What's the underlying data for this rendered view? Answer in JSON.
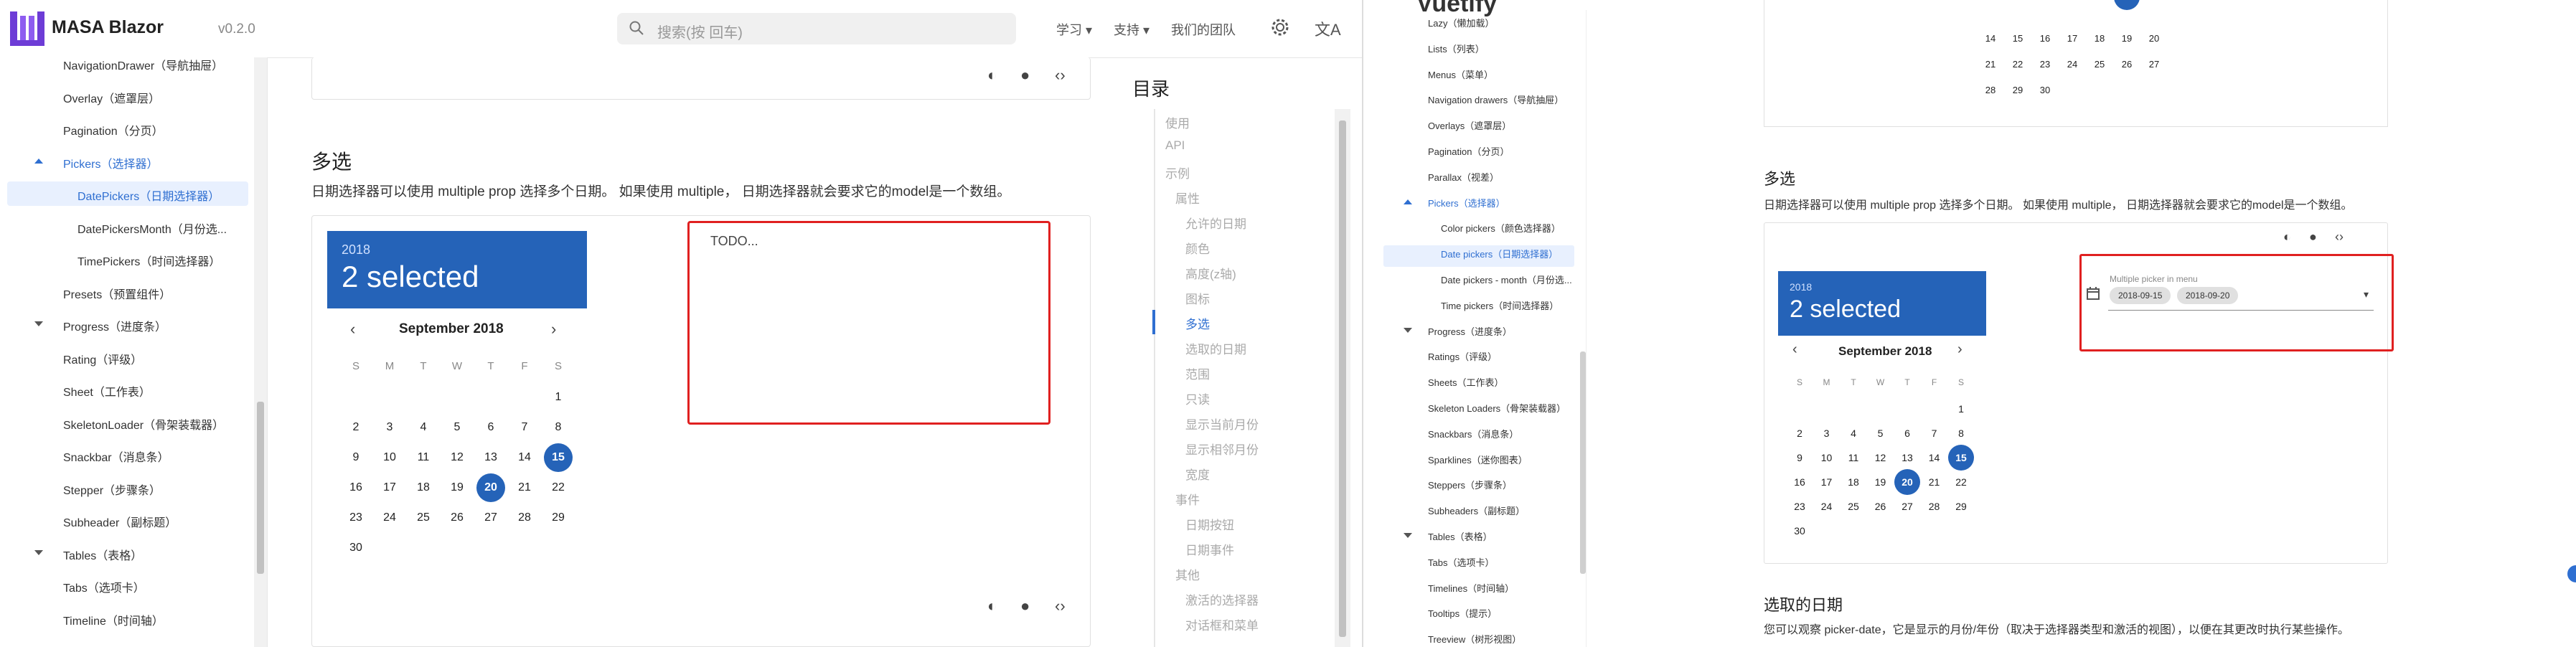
{
  "masa": {
    "brand": "MASA Blazor",
    "version": "v0.2.0",
    "search_placeholder": "搜索(按 回车)",
    "nav": [
      "学习",
      "支持",
      "我们的团队"
    ],
    "sidebar": [
      {
        "label": "NavigationDrawer（导航抽屉）",
        "kind": "item"
      },
      {
        "label": "Overlay（遮罩层）",
        "kind": "item"
      },
      {
        "label": "Pagination（分页）",
        "kind": "item"
      },
      {
        "label": "Pickers（选择器）",
        "kind": "group-open"
      },
      {
        "label": "DatePickers（日期选择器）",
        "kind": "sub-active"
      },
      {
        "label": "DatePickersMonth（月份选...",
        "kind": "sub"
      },
      {
        "label": "TimePickers（时间选择器）",
        "kind": "sub"
      },
      {
        "label": "Presets（预置组件）",
        "kind": "item"
      },
      {
        "label": "Progress（进度条）",
        "kind": "group"
      },
      {
        "label": "Rating（评级）",
        "kind": "item"
      },
      {
        "label": "Sheet（工作表）",
        "kind": "item"
      },
      {
        "label": "SkeletonLoader（骨架装载器）",
        "kind": "item"
      },
      {
        "label": "Snackbar（消息条）",
        "kind": "item"
      },
      {
        "label": "Stepper（步骤条）",
        "kind": "item"
      },
      {
        "label": "Subheader（副标题）",
        "kind": "item"
      },
      {
        "label": "Tables（表格）",
        "kind": "group"
      },
      {
        "label": "Tabs（选项卡）",
        "kind": "item"
      },
      {
        "label": "Timeline（时间轴）",
        "kind": "item"
      }
    ],
    "section_title": "多选",
    "section_desc": "日期选择器可以使用 multiple prop 选择多个日期。 如果使用 multiple， 日期选择器就会要求它的model是一个数组。",
    "picker": {
      "year": "2018",
      "selected": "2 selected",
      "month": "September 2018",
      "dows": [
        "S",
        "M",
        "T",
        "W",
        "T",
        "F",
        "S"
      ],
      "weeks": [
        [
          "",
          "",
          "",
          "",
          "",
          "",
          "1"
        ],
        [
          "2",
          "3",
          "4",
          "5",
          "6",
          "7",
          "8"
        ],
        [
          "9",
          "10",
          "11",
          "12",
          "13",
          "14",
          "15"
        ],
        [
          "16",
          "17",
          "18",
          "19",
          "20",
          "21",
          "22"
        ],
        [
          "23",
          "24",
          "25",
          "26",
          "27",
          "28",
          "29"
        ],
        [
          "30",
          "",
          "",
          "",
          "",
          "",
          ""
        ]
      ],
      "selected_days": [
        "15",
        "20"
      ]
    },
    "todo": "TODO...",
    "toc_title": "目录",
    "toc": [
      {
        "label": "使用",
        "level": 0
      },
      {
        "label": "API",
        "level": 0
      },
      {
        "label": "示例",
        "level": 0
      },
      {
        "label": "属性",
        "level": 1
      },
      {
        "label": "允许的日期",
        "level": 2
      },
      {
        "label": "颜色",
        "level": 2
      },
      {
        "label": "高度(z轴)",
        "level": 2
      },
      {
        "label": "图标",
        "level": 2
      },
      {
        "label": "多选",
        "level": 2,
        "active": true
      },
      {
        "label": "选取的日期",
        "level": 2
      },
      {
        "label": "范围",
        "level": 2
      },
      {
        "label": "只读",
        "level": 2
      },
      {
        "label": "显示当前月份",
        "level": 2
      },
      {
        "label": "显示相邻月份",
        "level": 2
      },
      {
        "label": "宽度",
        "level": 2
      },
      {
        "label": "事件",
        "level": 1
      },
      {
        "label": "日期按钮",
        "level": 2
      },
      {
        "label": "日期事件",
        "level": 2
      },
      {
        "label": "其他",
        "level": 1
      },
      {
        "label": "激活的选择器",
        "level": 2
      },
      {
        "label": "对话框和菜单",
        "level": 2
      }
    ]
  },
  "vuetify": {
    "brand": "Vuetify",
    "sidebar": [
      {
        "label": "Lazy（懒加载）",
        "kind": "item"
      },
      {
        "label": "Lists（列表）",
        "kind": "item"
      },
      {
        "label": "Menus（菜单）",
        "kind": "item"
      },
      {
        "label": "Navigation drawers（导航抽屉）",
        "kind": "item"
      },
      {
        "label": "Overlays（遮罩层）",
        "kind": "item"
      },
      {
        "label": "Pagination（分页）",
        "kind": "item"
      },
      {
        "label": "Parallax（视差）",
        "kind": "item"
      },
      {
        "label": "Pickers（选择器）",
        "kind": "group-open"
      },
      {
        "label": "Color pickers（颜色选择器）",
        "kind": "sub"
      },
      {
        "label": "Date pickers（日期选择器）",
        "kind": "sub-active"
      },
      {
        "label": "Date pickers - month（月份选...",
        "kind": "sub"
      },
      {
        "label": "Time pickers（时间选择器）",
        "kind": "sub"
      },
      {
        "label": "Progress（进度条）",
        "kind": "group"
      },
      {
        "label": "Ratings（评级）",
        "kind": "item"
      },
      {
        "label": "Sheets（工作表）",
        "kind": "item"
      },
      {
        "label": "Skeleton Loaders（骨架装载器）",
        "kind": "item"
      },
      {
        "label": "Snackbars（消息条）",
        "kind": "item"
      },
      {
        "label": "Sparklines（迷你图表）",
        "kind": "item"
      },
      {
        "label": "Steppers（步骤条）",
        "kind": "item"
      },
      {
        "label": "Subheaders（副标题）",
        "kind": "item"
      },
      {
        "label": "Tables（表格）",
        "kind": "group"
      },
      {
        "label": "Tabs（选项卡）",
        "kind": "item"
      },
      {
        "label": "Timelines（时间轴）",
        "kind": "item"
      },
      {
        "label": "Tooltips（提示）",
        "kind": "item"
      },
      {
        "label": "Treeview（树形视图）",
        "kind": "item"
      }
    ],
    "top_weeks": [
      [
        "14",
        "15",
        "16",
        "17",
        "18",
        "19",
        "20"
      ],
      [
        "21",
        "22",
        "23",
        "24",
        "25",
        "26",
        "27"
      ],
      [
        "28",
        "29",
        "30",
        "",
        "",
        "",
        ""
      ]
    ],
    "section_title": "多选",
    "section_desc": "日期选择器可以使用 multiple prop 选择多个日期。 如果使用 multiple， 日期选择器就会要求它的model是一个数组。",
    "picker": {
      "year": "2018",
      "selected": "2 selected",
      "month": "September 2018",
      "dows": [
        "S",
        "M",
        "T",
        "W",
        "T",
        "F",
        "S"
      ],
      "weeks": [
        [
          "",
          "",
          "",
          "",
          "",
          "",
          "1"
        ],
        [
          "2",
          "3",
          "4",
          "5",
          "6",
          "7",
          "8"
        ],
        [
          "9",
          "10",
          "11",
          "12",
          "13",
          "14",
          "15"
        ],
        [
          "16",
          "17",
          "18",
          "19",
          "20",
          "21",
          "22"
        ],
        [
          "23",
          "24",
          "25",
          "26",
          "27",
          "28",
          "29"
        ],
        [
          "30",
          "",
          "",
          "",
          "",
          "",
          ""
        ]
      ],
      "selected_days": [
        "15",
        "20"
      ]
    },
    "menu_label": "Multiple picker in menu",
    "chips": [
      "2018-09-15",
      "2018-09-20"
    ],
    "section2_title": "选取的日期",
    "section2_desc": "您可以观察 picker-date，它是显示的月份/年份（取决于选择器类型和激活的视图），以便在其更改时执行某些操作。"
  },
  "colors": {
    "accent": "#2563b8",
    "link": "#2f6fd1",
    "highlight_box": "#e02020"
  }
}
